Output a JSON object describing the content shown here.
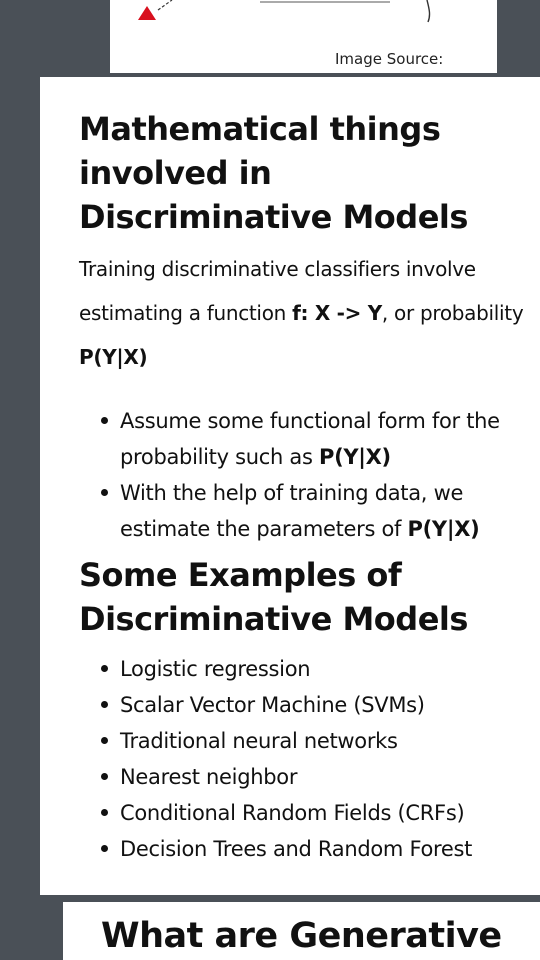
{
  "top_figure": {
    "caption": "Image Source:"
  },
  "section1": {
    "heading": "Mathematical things involved in Discriminative Models",
    "intro_1": "Training discriminative classifiers involve estimating a function ",
    "intro_bold_1": "f: X -> Y",
    "intro_2": ", or probability ",
    "intro_bold_2": "P(Y|X)",
    "steps": [
      {
        "text": "Assume some functional form for the probability such as ",
        "bold": "P(Y|X)"
      },
      {
        "text": "With the help of training data, we estimate the parameters of ",
        "bold": "P(Y|X)"
      }
    ]
  },
  "section2": {
    "heading": "Some Examples of Discriminative Models",
    "items": [
      "Logistic regression",
      "Scalar Vector Machine (SVMs)",
      "Traditional neural networks",
      "Nearest neighbor",
      "Conditional Random Fields (CRFs)",
      "Decision Trees and Random Forest"
    ]
  },
  "section3": {
    "heading": "What are Generative"
  }
}
